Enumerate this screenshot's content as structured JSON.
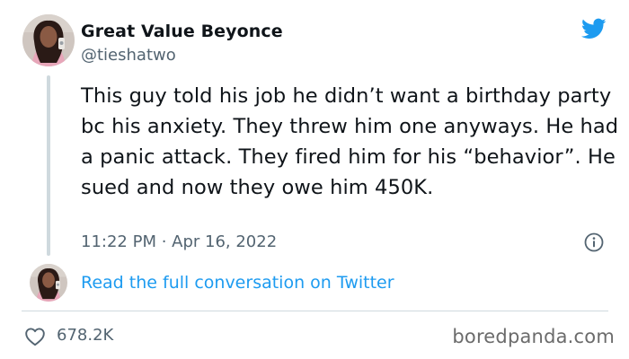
{
  "tweet": {
    "display_name": "Great Value Beyonce",
    "handle": "@tieshatwo",
    "text": "This guy told his job he didn’t want a birthday party bc his anxiety. They threw him one anyways. He had a panic attack. They fired him for his “behavior”. He sued and now they owe him 450K.",
    "timestamp": "11:22 PM · Apr 16, 2022",
    "like_count": "678.2K",
    "read_link": "Read the full conversation on Twitter"
  },
  "watermark": "boredpanda.com",
  "icons": {
    "brand": "twitter-bird-icon",
    "info": "info-icon",
    "like": "heart-icon"
  },
  "colors": {
    "twitter_blue": "#1d9bf0",
    "secondary_text": "#536471",
    "border": "#cfd9de"
  }
}
